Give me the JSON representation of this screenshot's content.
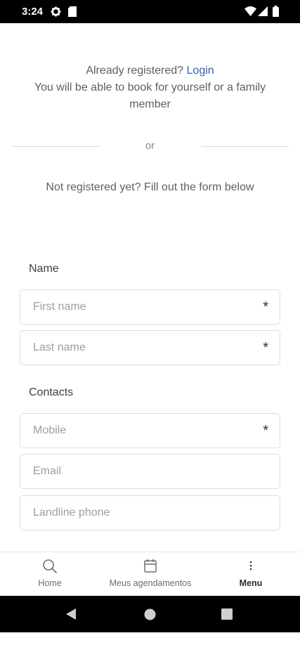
{
  "status_bar": {
    "time": "3:24"
  },
  "intro": {
    "already_registered": "Already registered?",
    "login_link": "Login",
    "book_note": "You will be able to book for yourself or a family member"
  },
  "divider": {
    "or_label": "or"
  },
  "not_registered": "Not registered yet? Fill out the form below",
  "form": {
    "name_section": "Name",
    "first_name_placeholder": "First name",
    "last_name_placeholder": "Last name",
    "contacts_section": "Contacts",
    "mobile_placeholder": "Mobile",
    "email_placeholder": "Email",
    "landline_placeholder": "Landline phone",
    "required_marker": "*"
  },
  "bottom_nav": {
    "home_label": "Home",
    "appointments_label": "Meus agendamentos",
    "menu_label": "Menu"
  },
  "icons": {
    "status": [
      "settings-icon",
      "sd-card-icon",
      "wifi-icon",
      "signal-icon",
      "battery-icon"
    ],
    "nav": [
      "search-icon",
      "calendar-icon",
      "more-vertical-icon"
    ],
    "system": [
      "back-icon",
      "home-circle-icon",
      "recents-icon"
    ]
  },
  "colors": {
    "link": "#2f62b3",
    "status_bar": "#000000"
  }
}
